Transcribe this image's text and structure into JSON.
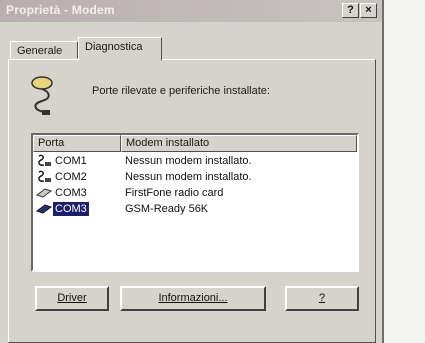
{
  "window": {
    "title": "Proprietà - Modem",
    "help_button": "?",
    "close_button": "×"
  },
  "tabs": [
    {
      "label": "Generale",
      "active": false
    },
    {
      "label": "Diagnostica",
      "active": true
    }
  ],
  "panel": {
    "heading": "Porte rilevate e periferiche installate:",
    "columns": {
      "port": "Porta",
      "modem": "Modem installato"
    },
    "rows": [
      {
        "port": "COM1",
        "modem": "Nessun modem installato.",
        "icon": "serial-port-icon",
        "selected": false
      },
      {
        "port": "COM2",
        "modem": "Nessun modem installato.",
        "icon": "serial-port-icon",
        "selected": false
      },
      {
        "port": "COM3",
        "modem": "FirstFone radio card",
        "icon": "pc-card-icon",
        "selected": false
      },
      {
        "port": "COM3",
        "modem": "GSM-Ready 56K",
        "icon": "pc-card-icon",
        "selected": true
      }
    ]
  },
  "buttons": {
    "driver": "Driver",
    "info": "Informazioni...",
    "help": "?"
  },
  "colors": {
    "selection": "#1b1f6b",
    "dialog_face": "#d6d3cc"
  }
}
